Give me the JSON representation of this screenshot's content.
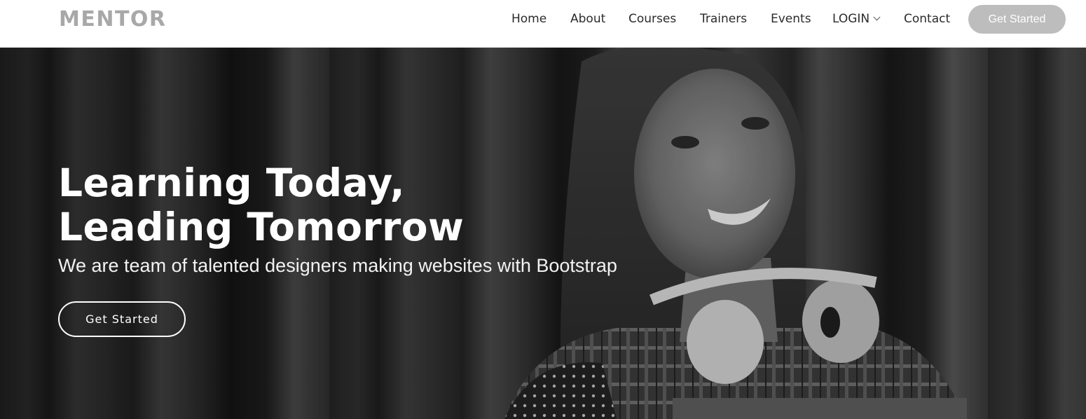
{
  "header": {
    "logo": "MENTOR",
    "nav": {
      "home": "Home",
      "about": "About",
      "courses": "Courses",
      "trainers": "Trainers",
      "events": "Events",
      "login": "LOGIN",
      "contact": "Contact"
    },
    "cta": "Get Started"
  },
  "hero": {
    "title_line1": "Learning Today,",
    "title_line2": "Leading Tomorrow",
    "subtitle": "We are team of talented designers making websites with Bootstrap",
    "cta": "Get Started"
  },
  "icons": {
    "login_dropdown": "chevron-down-icon"
  }
}
